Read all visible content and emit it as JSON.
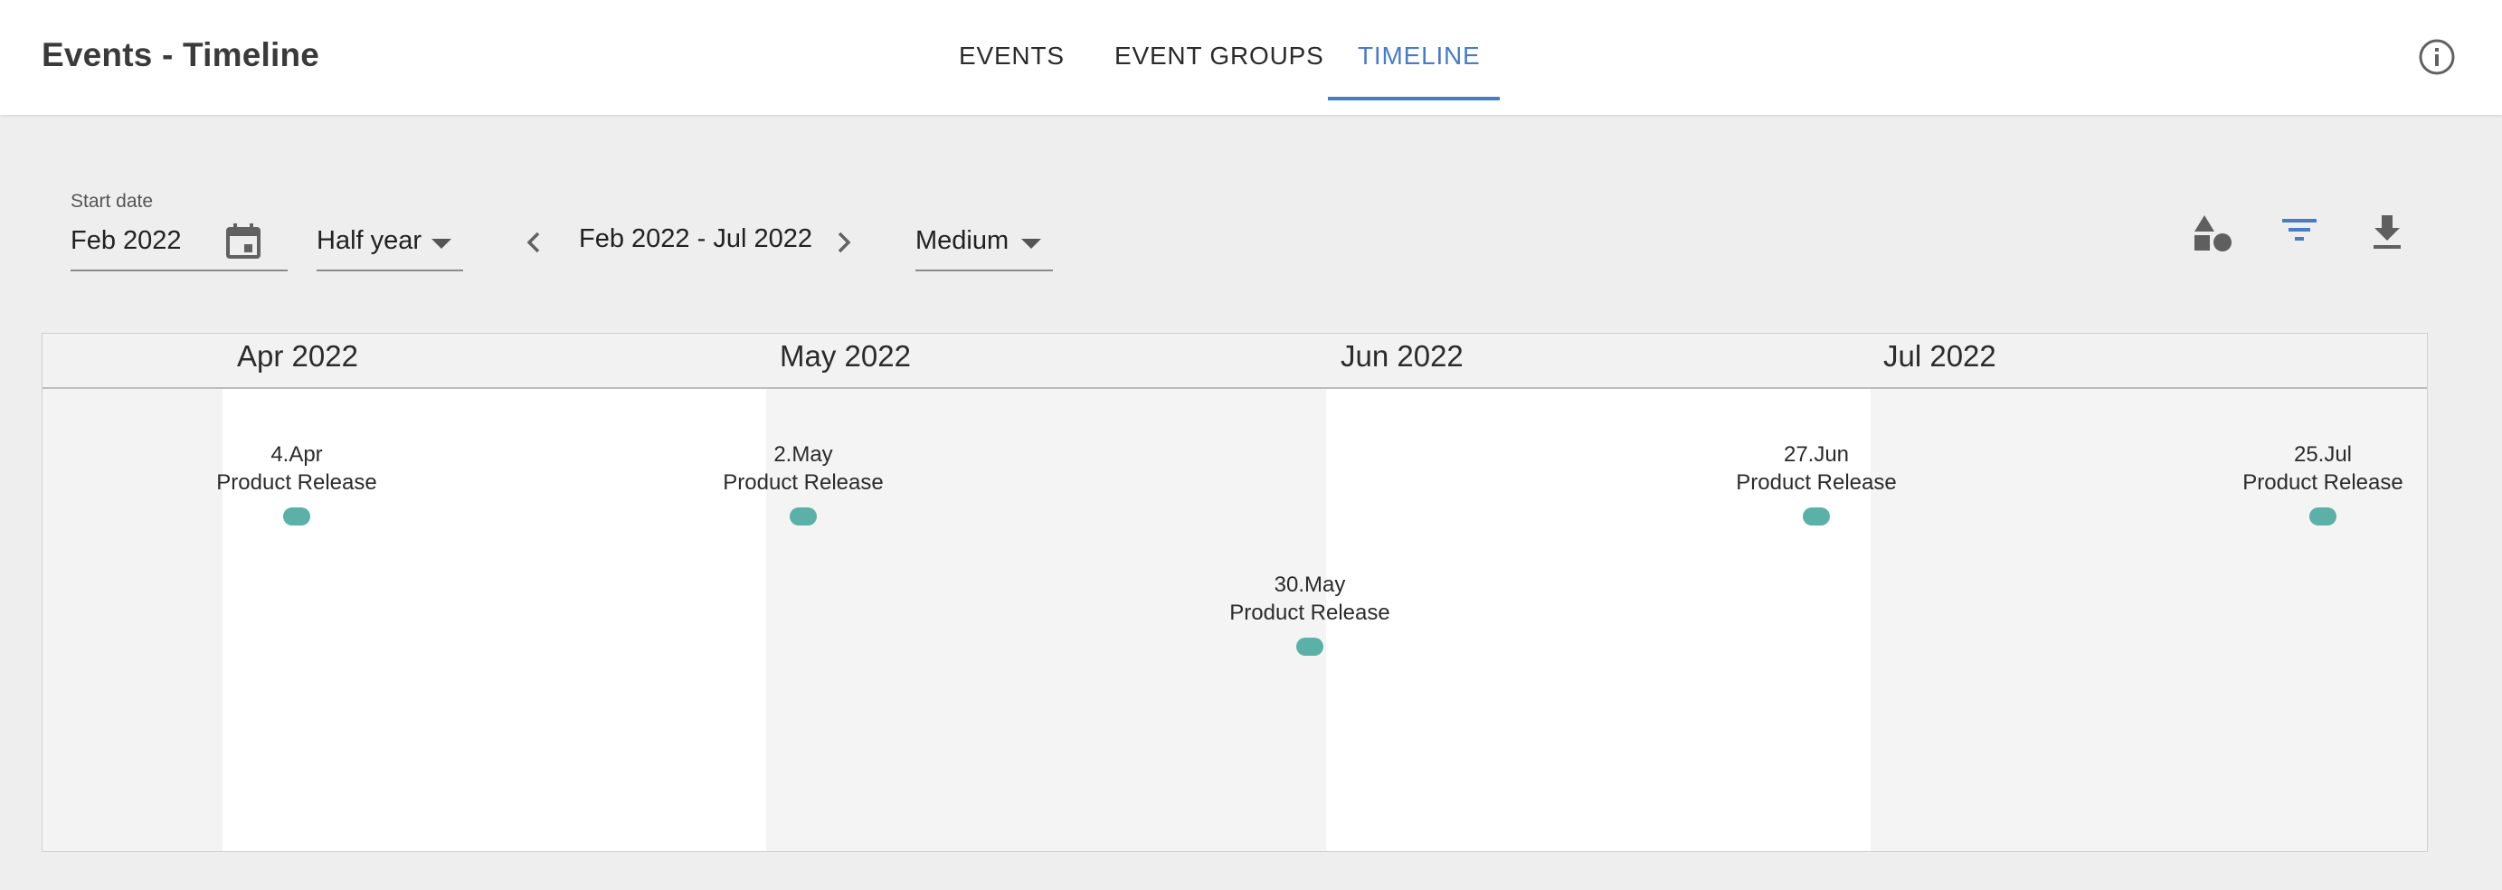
{
  "header": {
    "title": "Events - Timeline",
    "tabs": [
      {
        "label": "EVENTS",
        "active": false
      },
      {
        "label": "EVENT GROUPS",
        "active": false
      },
      {
        "label": "TIMELINE",
        "active": true
      }
    ],
    "accent_color": "#4a7cc4",
    "info_icon": "info-circle-icon"
  },
  "controls": {
    "start_date": {
      "label": "Start date",
      "value": "Feb 2022",
      "icon": "calendar-icon"
    },
    "period": {
      "value": "Half year"
    },
    "range": {
      "text": "Feb 2022 - Jul 2022"
    },
    "density": {
      "value": "Medium"
    },
    "tools": [
      {
        "icon": "shapes-icon",
        "color": "#5f5f5f"
      },
      {
        "icon": "filter-icon",
        "color": "#4a7cc4"
      },
      {
        "icon": "download-icon",
        "color": "#5f5f5f"
      }
    ]
  },
  "timeline": {
    "months": [
      {
        "label": "Apr 2022"
      },
      {
        "label": "May 2022"
      },
      {
        "label": "Jun 2022"
      },
      {
        "label": "Jul 2022"
      }
    ],
    "events": [
      {
        "date": "4.Apr",
        "name": "Product Release"
      },
      {
        "date": "2.May",
        "name": "Product Release"
      },
      {
        "date": "30.May",
        "name": "Product Release"
      },
      {
        "date": "27.Jun",
        "name": "Product Release"
      },
      {
        "date": "25.Jul",
        "name": "Product Release"
      }
    ],
    "event_color": "#5bb1a7"
  }
}
